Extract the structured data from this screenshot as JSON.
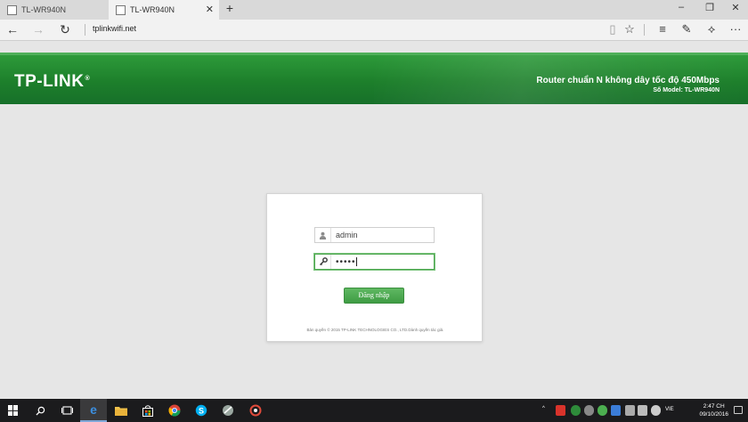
{
  "browser": {
    "tabs": [
      {
        "label": "TL-WR940N",
        "active": false
      },
      {
        "label": "TL-WR940N",
        "active": true
      }
    ],
    "new_tab_icon": "plus-icon",
    "address": "tplinkwifi.net"
  },
  "router": {
    "logo": "TP-LINK",
    "logo_mark": "®",
    "product": "Router chuẩn N không dây tốc độ 450Mbps",
    "model": "Số Model: TL-WR940N",
    "brand_color": "#1d7f2b"
  },
  "login": {
    "username": "admin",
    "password_masked": "•••••",
    "button_label": "Đăng nhập",
    "copyright": "Bản quyền © 2015 TP-LINK TECHNOLOGIES CO., LTD.Dành quyền tác giả."
  },
  "taskbar": {
    "language": "VIE",
    "time": "2:47 CH",
    "date": "09/10/2016"
  }
}
